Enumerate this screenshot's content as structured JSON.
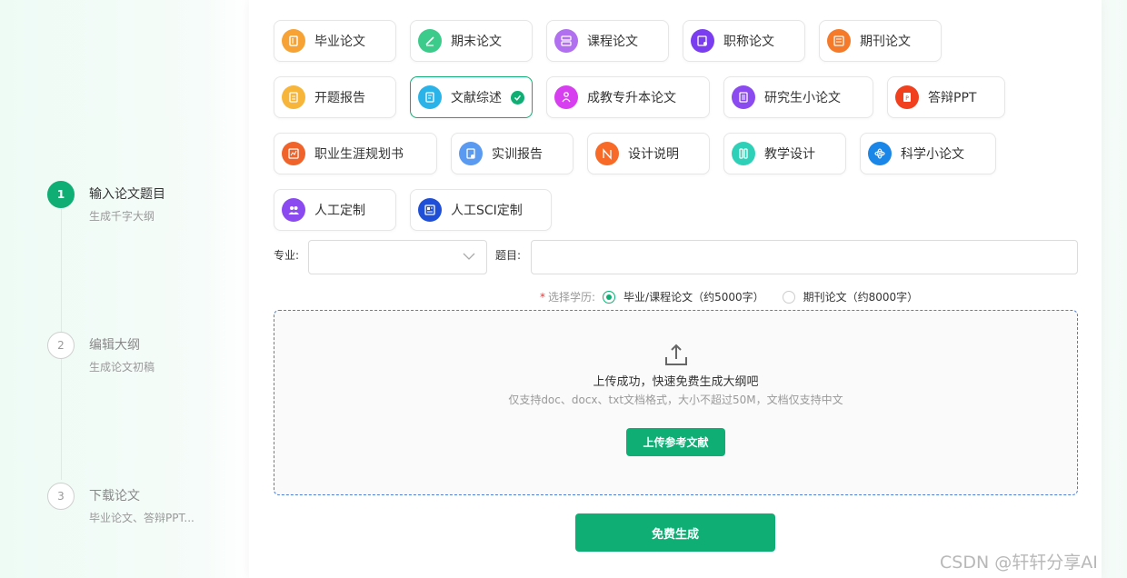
{
  "steps": [
    {
      "num": "1",
      "title": "输入论文题目",
      "sub": "生成千字大纲"
    },
    {
      "num": "2",
      "title": "编辑大纲",
      "sub": "生成论文初稿"
    },
    {
      "num": "3",
      "title": "下载论文",
      "sub": "毕业论文、答辩PPT..."
    }
  ],
  "types": [
    {
      "label": "毕业论文",
      "icon": "book-icon",
      "color": "#f7a235"
    },
    {
      "label": "期末论文",
      "icon": "pen-icon",
      "color": "#3ccb8a"
    },
    {
      "label": "课程论文",
      "icon": "layers-icon",
      "color": "#b070f0"
    },
    {
      "label": "职称论文",
      "icon": "certificate-icon",
      "color": "#7a3ef0"
    },
    {
      "label": "期刊论文",
      "icon": "journal-icon",
      "color": "#f57a2a"
    },
    {
      "label": "开题报告",
      "icon": "report-icon",
      "color": "#f7b53a"
    },
    {
      "label": "文献综述",
      "icon": "document-icon",
      "color": "#2ab3e8"
    },
    {
      "label": "成教专升本论文",
      "icon": "person-icon",
      "color": "#d63ef0"
    },
    {
      "label": "研究生小论文",
      "icon": "paper-icon",
      "color": "#8a4af0"
    },
    {
      "label": "答辩PPT",
      "icon": "ppt-icon",
      "color": "#f0401e"
    },
    {
      "label": "职业生涯规划书",
      "icon": "plan-icon",
      "color": "#f0632a"
    },
    {
      "label": "实训报告",
      "icon": "training-icon",
      "color": "#5a9af0"
    },
    {
      "label": "设计说明",
      "icon": "design-icon",
      "color": "#f76a28"
    },
    {
      "label": "教学设计",
      "icon": "teaching-icon",
      "color": "#2ed1b8"
    },
    {
      "label": "科学小论文",
      "icon": "atom-icon",
      "color": "#1a86e8"
    },
    {
      "label": "人工定制",
      "icon": "people-icon",
      "color": "#8a4af0"
    },
    {
      "label": "人工SCI定制",
      "icon": "sci-icon",
      "color": "#1e4fd6"
    }
  ],
  "selected_type": "文献综述",
  "form": {
    "major_label": "专业:",
    "major_value": "",
    "title_label": "题目:",
    "title_value": "",
    "edu_label": "选择学历:",
    "radio1": "毕业/课程论文（约5000字）",
    "radio2": "期刊论文（约8000字）",
    "selected_radio": 1
  },
  "upload": {
    "title": "上传成功，快速免费生成大纲吧",
    "sub": "仅支持doc、docx、txt文档格式，大小不超过50M，文档仅支持中文",
    "button": "上传参考文献"
  },
  "generate_button": "免费生成",
  "watermark": "CSDN @轩轩分享AI",
  "colors": {
    "accent": "#0fae75",
    "dashed_border": "#4c7ed9"
  }
}
